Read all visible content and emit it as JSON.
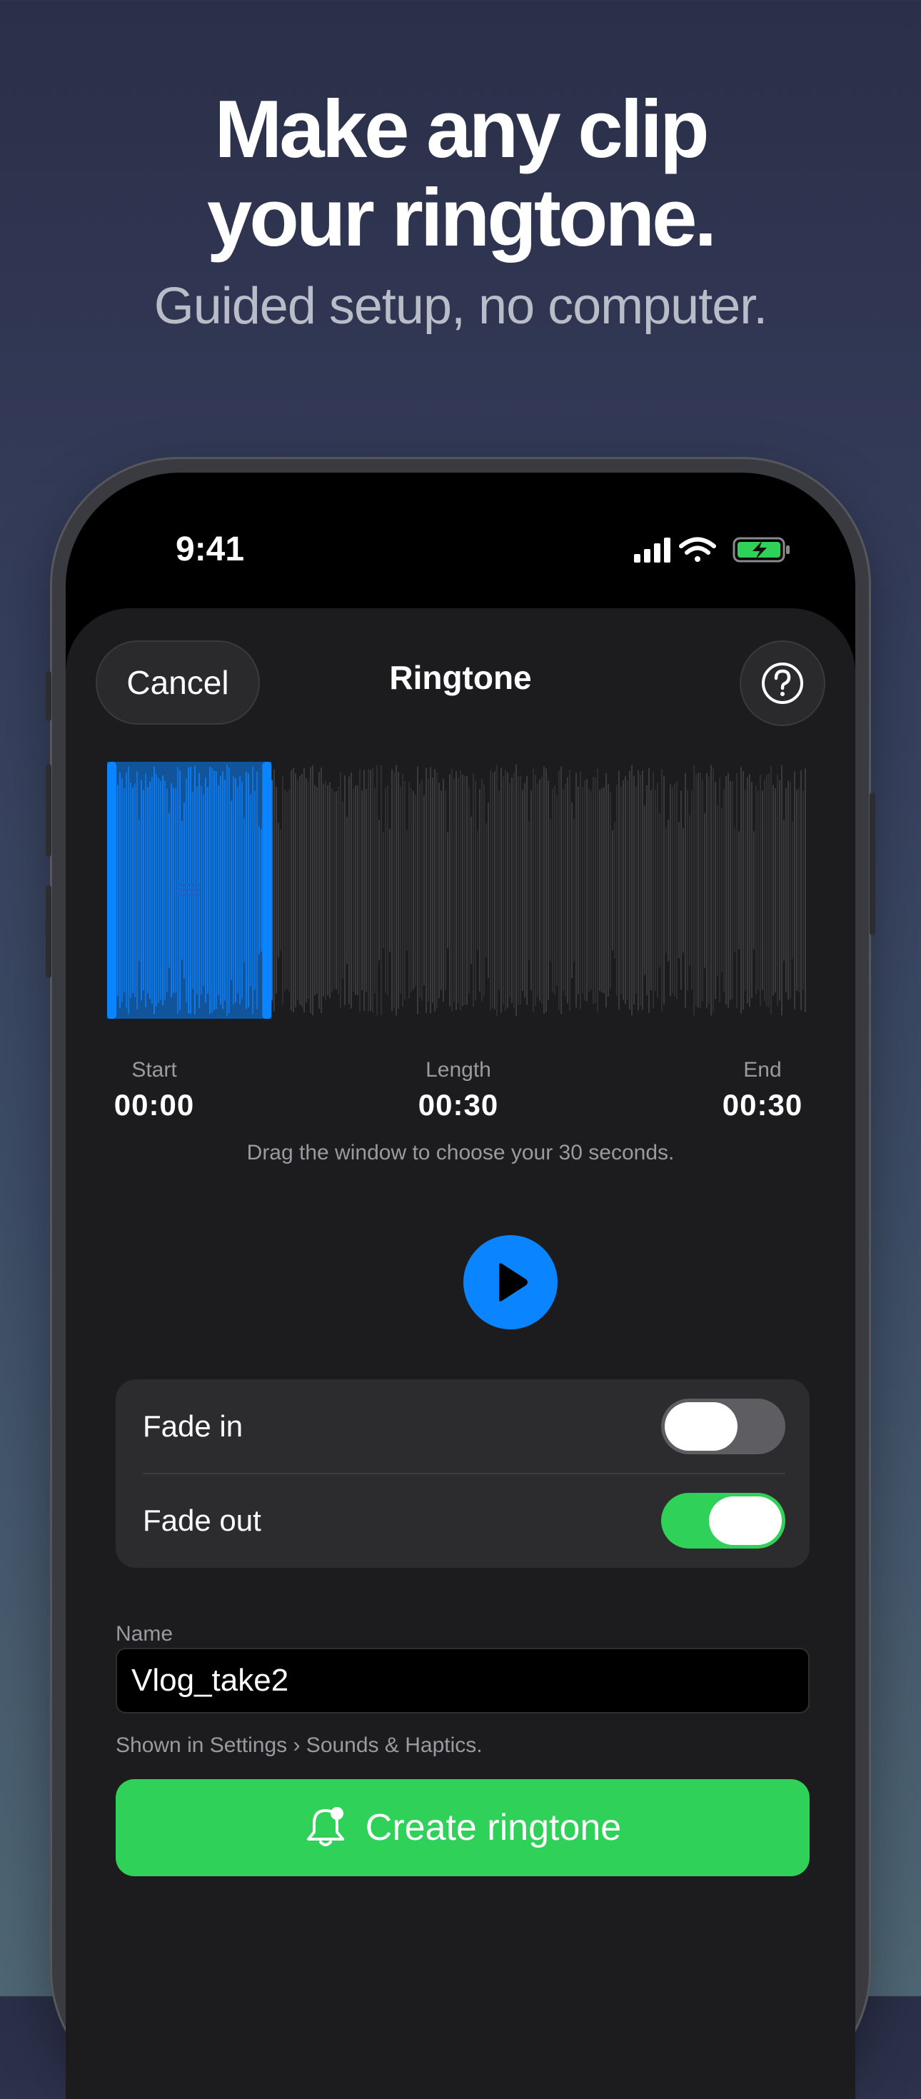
{
  "hero": {
    "title_line1": "Make any clip",
    "title_line2": "your ringtone.",
    "subtitle": "Guided setup, no computer."
  },
  "status_bar": {
    "time": "9:41",
    "icons": [
      "cellular-signal-icon",
      "wifi-icon",
      "battery-charging-icon"
    ]
  },
  "header": {
    "cancel_label": "Cancel",
    "title": "Ringtone",
    "help_icon": "question-mark-icon"
  },
  "waveform": {
    "selection_start_fraction": 0.0,
    "selection_end_fraction": 0.235,
    "handle_icon": "drag-lines-icon"
  },
  "times": {
    "start_label": "Start",
    "start_value": "00:00",
    "length_label": "Length",
    "length_value": "00:30",
    "end_label": "End",
    "end_value": "00:30"
  },
  "hint": "Drag the window to choose your 30 seconds.",
  "play_icon": "play-icon",
  "toggles": [
    {
      "label": "Fade in",
      "on": false
    },
    {
      "label": "Fade out",
      "on": true
    }
  ],
  "name_field": {
    "label": "Name",
    "value": "Vlog_take2",
    "help": "Shown in Settings › Sounds & Haptics."
  },
  "create_button": {
    "label": "Create ringtone",
    "icon": "bell-badge-icon"
  },
  "colors": {
    "accent_blue": "#0a84ff",
    "accent_green": "#30d158",
    "sheet_bg": "#1c1c1e",
    "card_bg": "#2c2c2e"
  }
}
